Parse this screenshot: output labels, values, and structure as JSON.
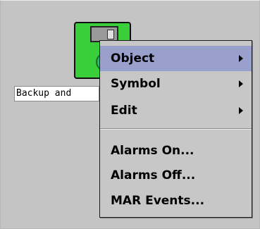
{
  "desktop": {
    "object": {
      "icon": "floppy-disk-icon",
      "label": "Backup and"
    }
  },
  "menu": {
    "items": [
      {
        "label": "Object",
        "has_submenu": true,
        "selected": true
      },
      {
        "label": "Symbol",
        "has_submenu": true,
        "selected": false
      },
      {
        "label": "Edit",
        "has_submenu": true,
        "selected": false
      },
      {
        "label": "Alarms On...",
        "has_submenu": false,
        "selected": false
      },
      {
        "label": "Alarms Off...",
        "has_submenu": false,
        "selected": false
      },
      {
        "label": "MAR Events...",
        "has_submenu": false,
        "selected": false
      }
    ]
  },
  "colors": {
    "background": "#c4c4c4",
    "menu_background": "#c7c7c7",
    "menu_highlight": "#9aa0cc",
    "icon_green": "#39cf3b"
  }
}
